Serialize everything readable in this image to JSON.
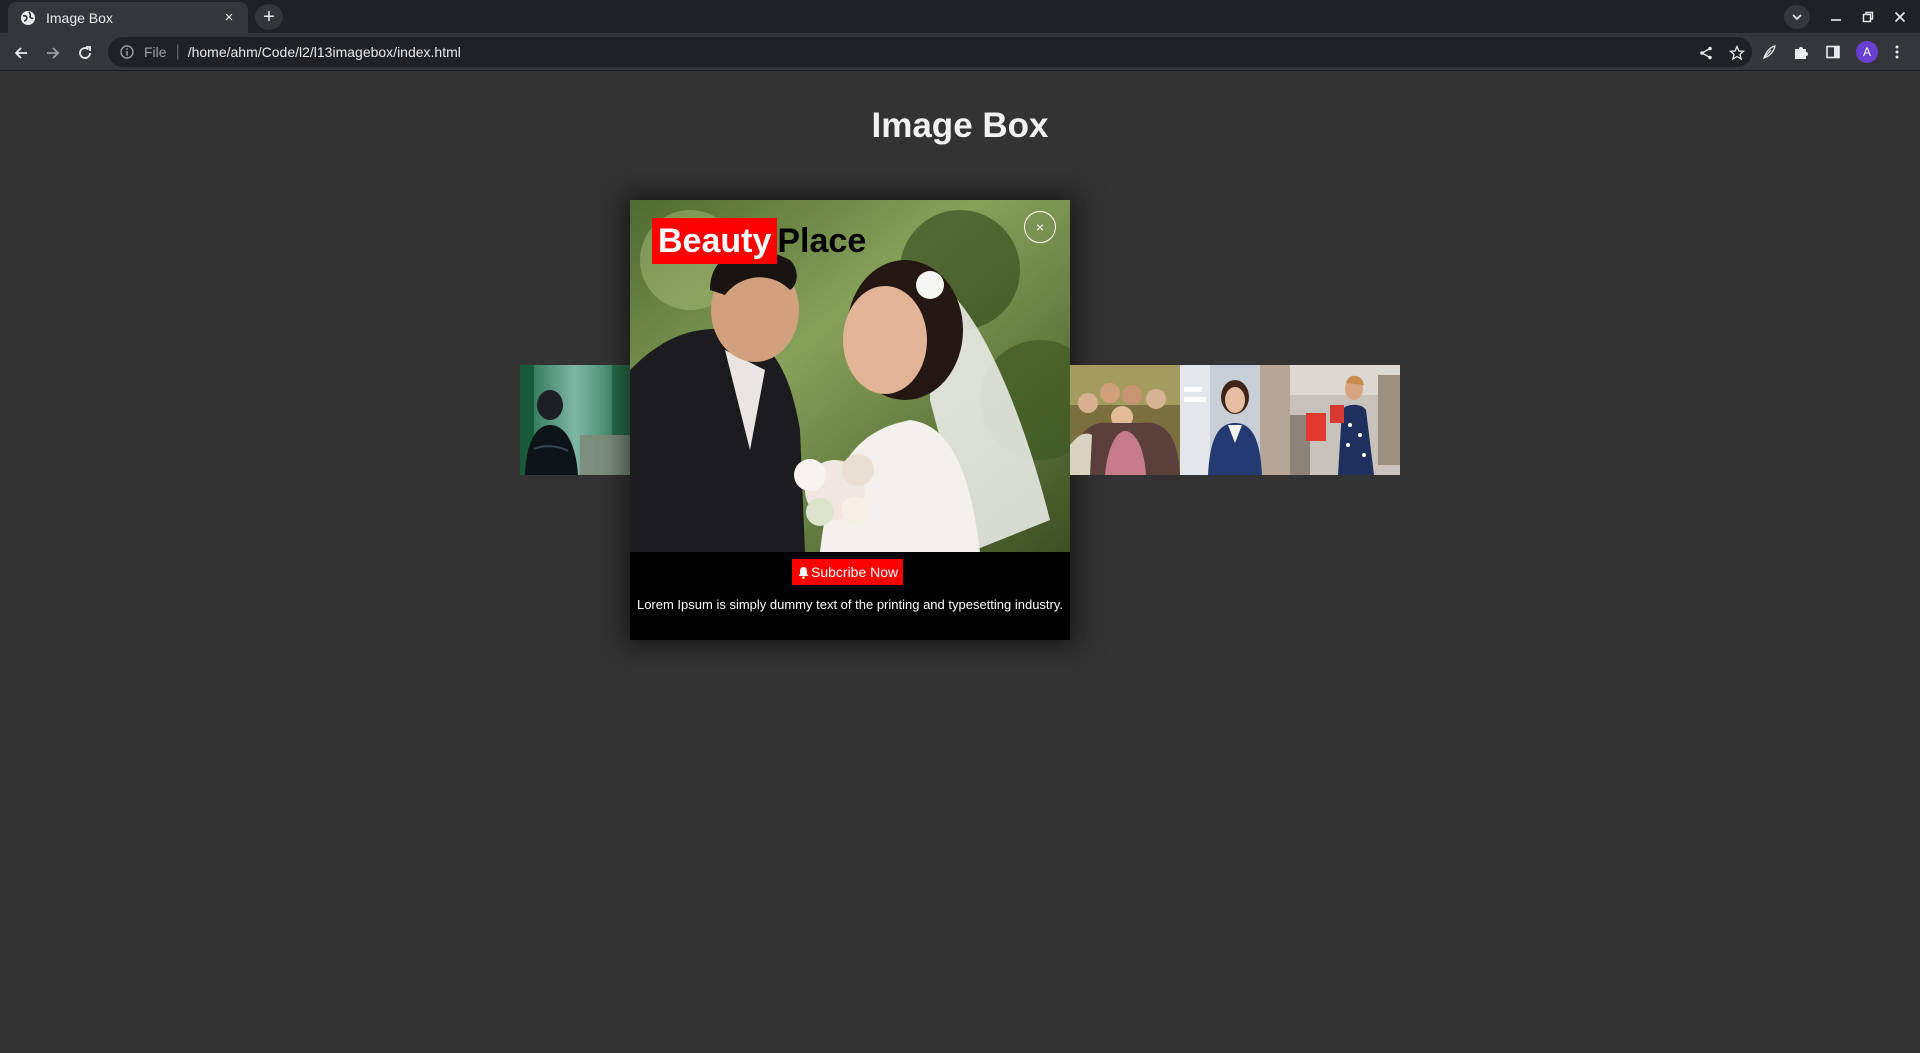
{
  "browser": {
    "tab_title": "Image Box",
    "tab_close": "×",
    "new_tab": "+",
    "url_scheme": "File",
    "url_separator": "|",
    "url": "/home/ahm/Code/l2/l13imagebox/index.html",
    "profile_initial": "A"
  },
  "page": {
    "title": "Image Box"
  },
  "thumbnails": [
    {
      "name": "man-forest-image"
    },
    {
      "name": "group-friends-image"
    },
    {
      "name": "businesswoman-image"
    },
    {
      "name": "shopping-woman-image"
    }
  ],
  "modal": {
    "brand_highlight": "Beauty",
    "brand_rest": "Place",
    "close_label": "×",
    "subscribe_label": "Subcribe Now",
    "description": "Lorem Ipsum is simply dummy text of the printing and typesetting industry.",
    "image_name": "wedding-couple-image"
  },
  "colors": {
    "page_bg": "#333333",
    "accent": "#ff0000",
    "chrome_bg": "#202124",
    "toolbar_bg": "#35363a"
  }
}
